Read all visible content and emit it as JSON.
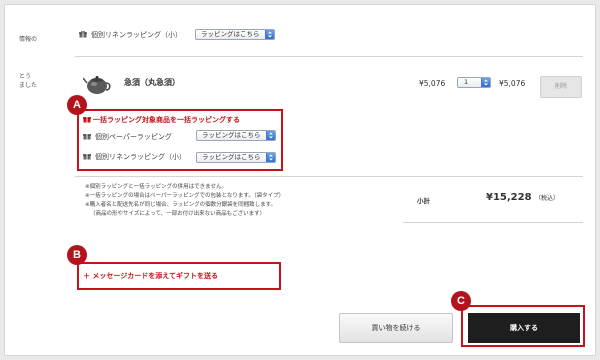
{
  "left_labels": {
    "label1": "情報の",
    "label2": "とう",
    "label3": "ました"
  },
  "top_row": {
    "wrap_name": "個別リネンラッピング（小）",
    "select_value": "ラッピングはこちら"
  },
  "item": {
    "name": "急須（丸急須）",
    "unit_price": "¥5,076",
    "quantity": "1",
    "line_total": "¥5,076",
    "delete_label": "削除"
  },
  "bulk_wrap": {
    "link_label": "一括ラッピング対象商品を一括ラッピングする",
    "options": [
      {
        "name": "個別ペーパーラッピング",
        "select_value": "ラッピングはこちら"
      },
      {
        "name": "個別リネンラッピング（小）",
        "select_value": "ラッピングはこちら"
      }
    ]
  },
  "notes": [
    "※個別ラッピングと一括ラッピングの併用はできません。",
    "※一括ラッピングの場合はペーパーラッピングでの包装となります。（袋タイプ）",
    "※購入者名と配送先名が同じ場合、ラッピングの個数分銀袋を同梱致します。",
    "（商品の形やサイズによって、一部お付け出来ない商品もございます）"
  ],
  "subtotal": {
    "label": "小計",
    "value": "¥15,228",
    "tax_note": "（税込）"
  },
  "message_card": {
    "link_label": "＋ メッセージカードを添えてギフトを送る"
  },
  "buttons": {
    "continue_label": "買い物を続ける",
    "buy_label": "購入する"
  },
  "callouts": {
    "a": "A",
    "b": "B",
    "c": "C"
  },
  "colors": {
    "accent_red": "#c4141b",
    "callout_red": "#b3141c",
    "buy_button": "#1e1e1e",
    "select_arrow_blue": "#2f6fd0"
  },
  "icons": {
    "gift": "gift-box-icon",
    "teapot": "teapot-image",
    "select_arrow": "select-arrows-icon"
  }
}
